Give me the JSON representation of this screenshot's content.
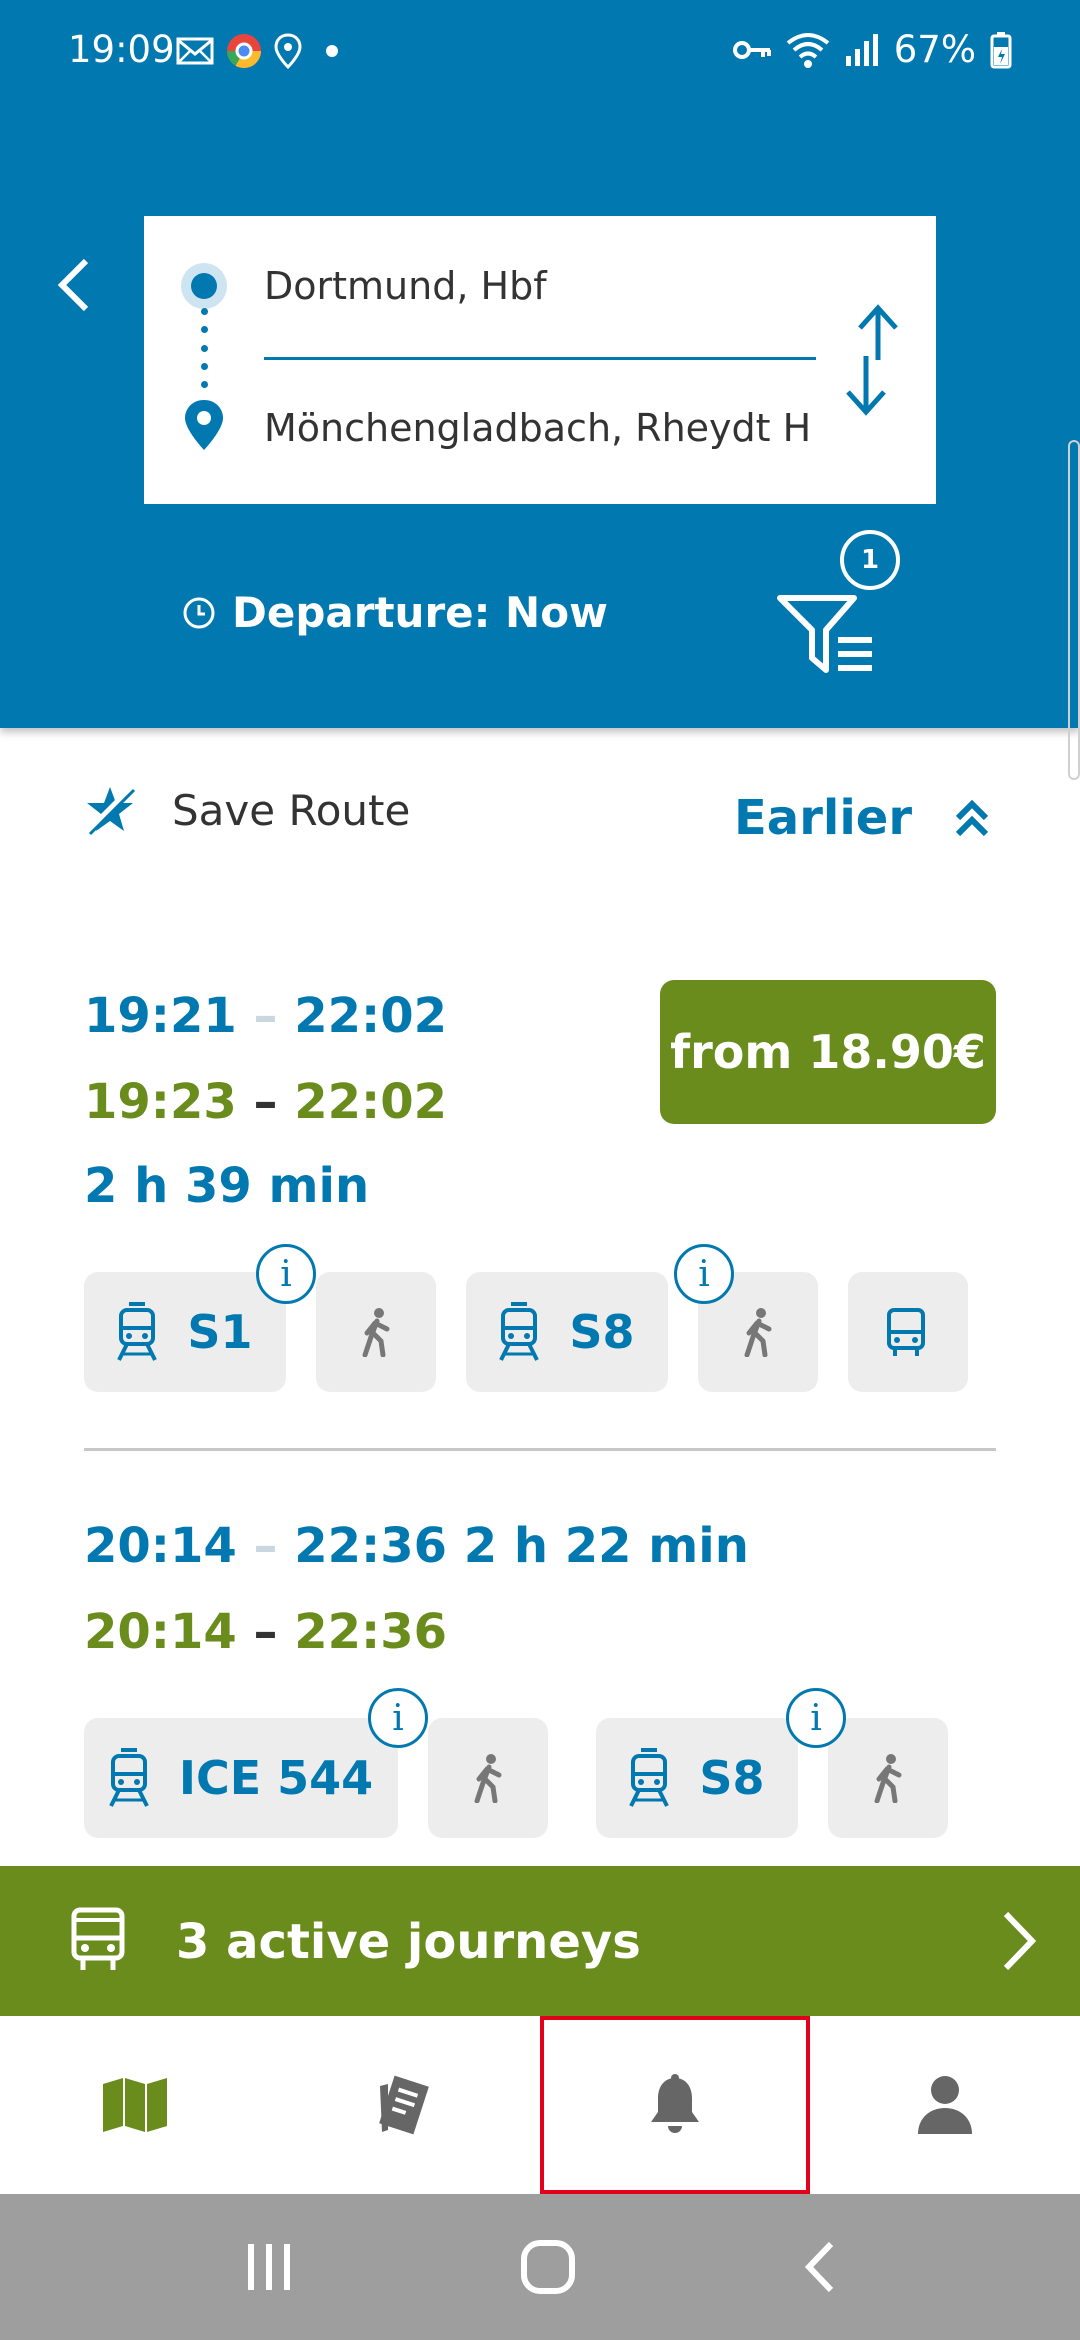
{
  "status_bar": {
    "time": "19:09",
    "battery": "67%",
    "icons_left": [
      "mail-icon",
      "chrome-icon",
      "location-icon",
      "dot-icon"
    ],
    "icons_right": [
      "vpn-key-icon",
      "wifi-icon",
      "signal-icon",
      "battery-icon"
    ]
  },
  "search": {
    "origin": "Dortmund, Hbf",
    "destination": "Mönchengladbach, Rheydt H",
    "departure": "Departure: Now",
    "filter_count": "1"
  },
  "actions": {
    "save_route": "Save Route",
    "earlier": "Earlier"
  },
  "trips": [
    {
      "planned_departure": "19:21",
      "planned_arrival": "22:02",
      "actual_departure": "19:23",
      "actual_arrival": "22:02",
      "duration": "2 h 39 min",
      "price": "from 18.90€",
      "legs": [
        {
          "type": "train",
          "label": "S1",
          "info": "i"
        },
        {
          "type": "walk",
          "label": ""
        },
        {
          "type": "train",
          "label": "S8",
          "info": "i"
        },
        {
          "type": "walk",
          "label": ""
        },
        {
          "type": "bus",
          "label": ""
        }
      ]
    },
    {
      "planned_departure": "20:14",
      "planned_arrival": "22:36",
      "actual_departure": "20:14",
      "actual_arrival": "22:36",
      "duration": "2 h 22 min",
      "legs": [
        {
          "type": "train",
          "label": "ICE 544",
          "info": "i"
        },
        {
          "type": "walk",
          "label": ""
        },
        {
          "type": "train",
          "label": "S8",
          "info": "i"
        },
        {
          "type": "walk",
          "label": ""
        }
      ]
    }
  ],
  "active_journeys": {
    "label": "3 active journeys"
  },
  "bottom_nav": [
    "map-icon",
    "tickets-icon",
    "bell-icon",
    "profile-icon"
  ],
  "colors": {
    "primary_blue": "#0179b0",
    "accent_green": "#6a8c1c",
    "leg_background": "#ededed",
    "highlight_red": "#e3001b"
  }
}
